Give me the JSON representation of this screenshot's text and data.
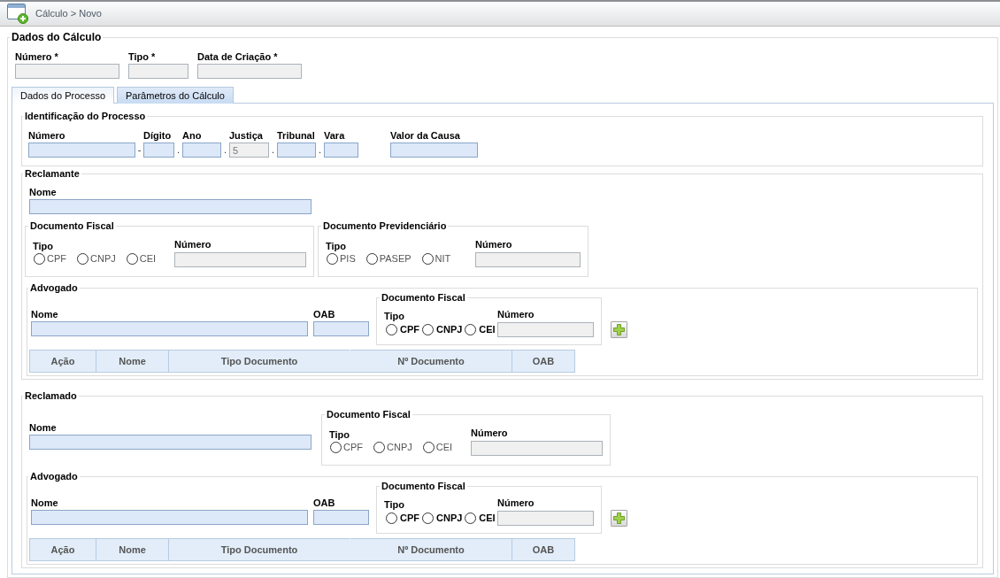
{
  "header": {
    "breadcrumb": "Cálculo > Novo"
  },
  "dados_calculo": {
    "legend": "Dados do Cálculo",
    "fields": [
      {
        "label": "Número *",
        "disabled": true
      },
      {
        "label": "Tipo *",
        "disabled": true
      },
      {
        "label": "Data de Criação *",
        "disabled": true
      }
    ]
  },
  "tabs": [
    {
      "label": "Dados do Processo",
      "selected": true
    },
    {
      "label": "Parâmetros do Cálculo",
      "selected": false
    }
  ],
  "identificacao": {
    "legend": "Identificação do Processo",
    "fields": [
      {
        "label": "Número",
        "disabled": false,
        "separator": "-"
      },
      {
        "label": "Dígito",
        "disabled": false,
        "separator": "."
      },
      {
        "label": "Ano",
        "disabled": false,
        "separator": "."
      },
      {
        "label": "Justiça",
        "disabled": true,
        "value": "5",
        "separator": "."
      },
      {
        "label": "Tribunal",
        "disabled": false,
        "separator": "."
      },
      {
        "label": "Vara",
        "disabled": false
      },
      {
        "label": "Valor da Causa",
        "disabled": false
      }
    ]
  },
  "reclamante": {
    "legend": "Reclamante",
    "nome": {
      "label": "Nome",
      "disabled": false
    },
    "documento_fiscal": {
      "legend": "Documento Fiscal",
      "tipo_label": "Tipo",
      "options": [
        {
          "label": "CPF",
          "selected": false
        },
        {
          "label": "CNPJ",
          "selected": false
        },
        {
          "label": "CEI",
          "selected": false
        }
      ],
      "numero": {
        "label": "Número",
        "disabled": true
      }
    },
    "documento_previdenciario": {
      "legend": "Documento Previdenciário",
      "tipo_label": "Tipo",
      "options": [
        {
          "label": "PIS",
          "selected": false
        },
        {
          "label": "PASEP",
          "selected": false
        },
        {
          "label": "NIT",
          "selected": false
        }
      ],
      "numero": {
        "label": "Número",
        "disabled": true
      }
    },
    "advogado": {
      "legend": "Advogado",
      "nome": {
        "label": "Nome",
        "disabled": false
      },
      "oab": {
        "label": "OAB",
        "disabled": false
      },
      "documento_fiscal": {
        "legend": "Documento Fiscal",
        "tipo_label": "Tipo",
        "options": [
          {
            "label": "CPF",
            "selected": false
          },
          {
            "label": "CNPJ",
            "selected": false
          },
          {
            "label": "CEI",
            "selected": false
          }
        ],
        "numero": {
          "label": "Número",
          "disabled": true
        }
      },
      "table": {
        "columns": [
          "Ação",
          "Nome",
          "Tipo Documento",
          "Nº Documento",
          "OAB"
        ]
      }
    }
  },
  "reclamado": {
    "legend": "Reclamado",
    "nome": {
      "label": "Nome",
      "disabled": false
    },
    "documento_fiscal": {
      "legend": "Documento Fiscal",
      "tipo_label": "Tipo",
      "options": [
        {
          "label": "CPF",
          "selected": false
        },
        {
          "label": "CNPJ",
          "selected": false
        },
        {
          "label": "CEI",
          "selected": false
        }
      ],
      "numero": {
        "label": "Número",
        "disabled": true
      }
    },
    "advogado": {
      "legend": "Advogado",
      "nome": {
        "label": "Nome",
        "disabled": false
      },
      "oab": {
        "label": "OAB",
        "disabled": false
      },
      "documento_fiscal": {
        "legend": "Documento Fiscal",
        "tipo_label": "Tipo",
        "options": [
          {
            "label": "CPF",
            "selected": false
          },
          {
            "label": "CNPJ",
            "selected": false
          },
          {
            "label": "CEI",
            "selected": false
          }
        ],
        "numero": {
          "label": "Número",
          "disabled": true
        }
      },
      "table": {
        "columns": [
          "Ação",
          "Nome",
          "Tipo Documento",
          "Nº Documento",
          "OAB"
        ]
      }
    }
  }
}
